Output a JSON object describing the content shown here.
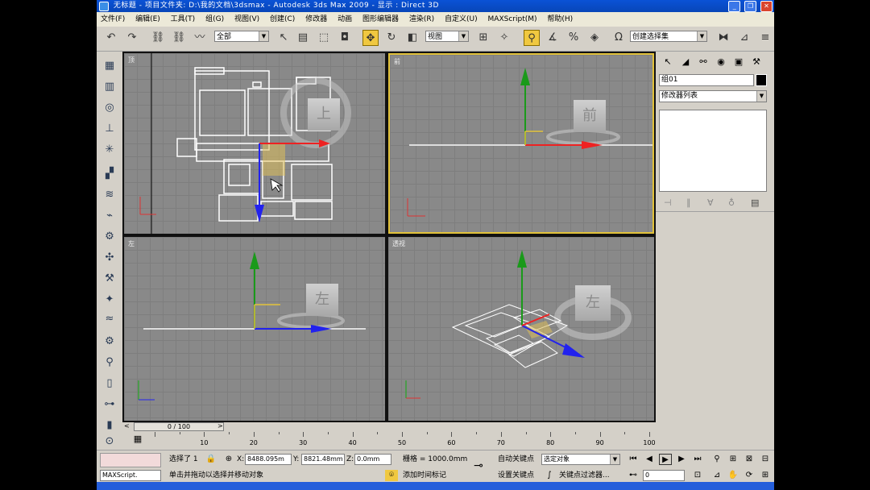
{
  "window": {
    "title": "无标题   - 项目文件夹: D:\\我的文档\\3dsmax     - Autodesk 3ds Max  2009     - 显示 : Direct 3D",
    "minimize": "_",
    "restore": "❐",
    "close": "✕"
  },
  "menu": [
    "文件(F)",
    "编辑(E)",
    "工具(T)",
    "组(G)",
    "视图(V)",
    "创建(C)",
    "修改器",
    "动画",
    "图形编辑器",
    "渲染(R)",
    "自定义(U)",
    "MAXScript(M)",
    "帮助(H)"
  ],
  "toolbar": {
    "selection_filter": "全部",
    "reference_coord": "视图",
    "named_selection": "创建选择集"
  },
  "viewports": {
    "top": {
      "label": "顶",
      "cube": "上"
    },
    "front": {
      "label": "前",
      "cube": "前"
    },
    "left": {
      "label": "左",
      "cube": "左"
    },
    "perspective": {
      "label": "透视",
      "cube": "左"
    }
  },
  "right_panel": {
    "object_name": "组01",
    "modifier_list": "修改器列表"
  },
  "timeline": {
    "slider": "0 / 100",
    "ticks": [
      {
        "v": 10,
        "label": "10"
      },
      {
        "v": 20,
        "label": "20"
      },
      {
        "v": 30,
        "label": "30"
      },
      {
        "v": 40,
        "label": "40"
      },
      {
        "v": 50,
        "label": "50"
      },
      {
        "v": 60,
        "label": "60"
      },
      {
        "v": 70,
        "label": "70"
      },
      {
        "v": 80,
        "label": "80"
      },
      {
        "v": 90,
        "label": "90"
      },
      {
        "v": 100,
        "label": "100"
      }
    ]
  },
  "status": {
    "maxscript": "MAXScript.",
    "selected": "选择了 1",
    "x_label": "X:",
    "x_value": "8488.095m",
    "y_label": "Y:",
    "y_value": "8821.48mm",
    "z_label": "Z:",
    "z_value": "0.0mm",
    "grid": "栅格 = 1000.0mm",
    "auto_key": "自动关键点",
    "selected_object": "选定对象",
    "set_key": "设置关键点",
    "key_filters": "关键点过滤器...",
    "prompt": "单击并拖动以选择并移动对象",
    "add_time_tag": "添加时间标记",
    "frame": "0"
  }
}
